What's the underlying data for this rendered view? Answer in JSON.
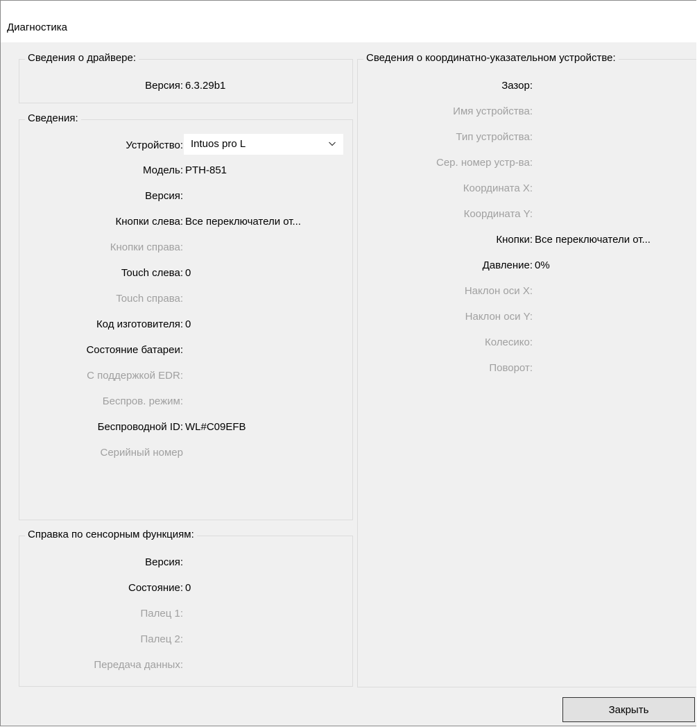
{
  "window": {
    "title": "Диагностика"
  },
  "driver": {
    "legend": "Сведения о драйвере:",
    "version_label": "Версия:",
    "version_value": "6.3.29b1"
  },
  "info": {
    "legend": "Сведения:",
    "device_label": "Устройство:",
    "device_selected": "Intuos pro L",
    "model_label": "Модель:",
    "model_value": "PTH-851",
    "version_label": "Версия:",
    "version_value": "",
    "left_buttons_label": "Кнопки слева:",
    "left_buttons_value": "Все переключатели от...",
    "right_buttons_label": "Кнопки справа:",
    "touch_left_label": "Touch слева:",
    "touch_left_value": "0",
    "touch_right_label": "Touch справа:",
    "vendor_label": "Код изготовителя:",
    "vendor_value": "0",
    "battery_label": "Состояние батареи:",
    "edr_label": "С поддержкой EDR:",
    "wireless_mode_label": "Беспров. режим:",
    "wireless_id_label": "Беспроводной ID:",
    "wireless_id_value": "WL#C09EFB",
    "serial_label": "Серийный номер"
  },
  "touch": {
    "legend": "Справка по сенсорным функциям:",
    "version_label": "Версия:",
    "state_label": "Состояние:",
    "state_value": "0",
    "finger1_label": "Палец 1:",
    "finger2_label": "Палец 2:",
    "transfer_label": "Передача данных:"
  },
  "pointer": {
    "legend": "Сведения о координатно-указательном устройстве:",
    "gap_label": "Зазор:",
    "device_name_label": "Имя устройства:",
    "device_type_label": "Тип устройства:",
    "serial_label": "Сер. номер устр-ва:",
    "coord_x_label": "Координата X:",
    "coord_y_label": "Координата Y:",
    "buttons_label": "Кнопки:",
    "buttons_value": "Все переключатели от...",
    "pressure_label": "Давление:",
    "pressure_value": "0%",
    "tilt_x_label": "Наклон оси X:",
    "tilt_y_label": "Наклон оси Y:",
    "wheel_label": "Колесико:",
    "rotation_label": "Поворот:"
  },
  "buttons": {
    "close_label": "Закрыть"
  },
  "icons": {
    "combo_arrow": "chevron-down-icon"
  },
  "colors": {
    "disabled_text": "#a0a0a0",
    "dialog_bg": "#f0f0f0"
  }
}
